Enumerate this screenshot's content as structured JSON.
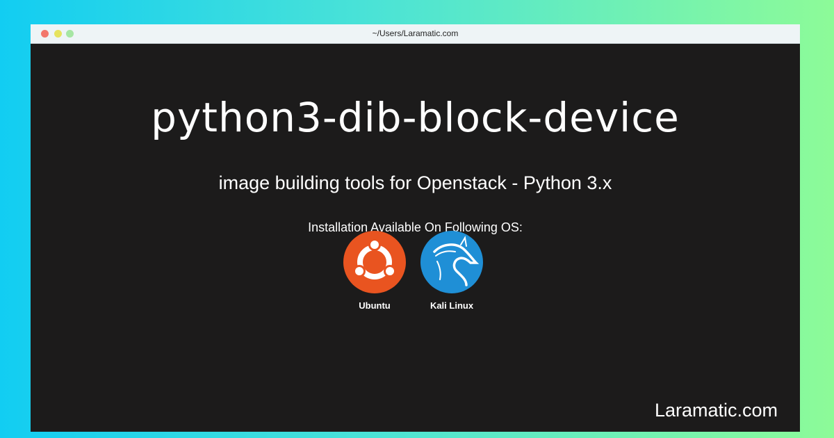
{
  "window": {
    "url": "~/Users/Laramatic.com"
  },
  "main": {
    "title": "python3-dib-block-device",
    "subtitle": "image building tools for Openstack - Python 3.x",
    "os_heading": "Installation Available On Following OS:"
  },
  "os_list": [
    {
      "label": "Ubuntu",
      "icon": "ubuntu-icon",
      "color": "#e95420"
    },
    {
      "label": "Kali Linux",
      "icon": "kali-linux-icon",
      "color": "#1f8fd6"
    }
  ],
  "footer": {
    "brand": "Laramatic.com"
  }
}
